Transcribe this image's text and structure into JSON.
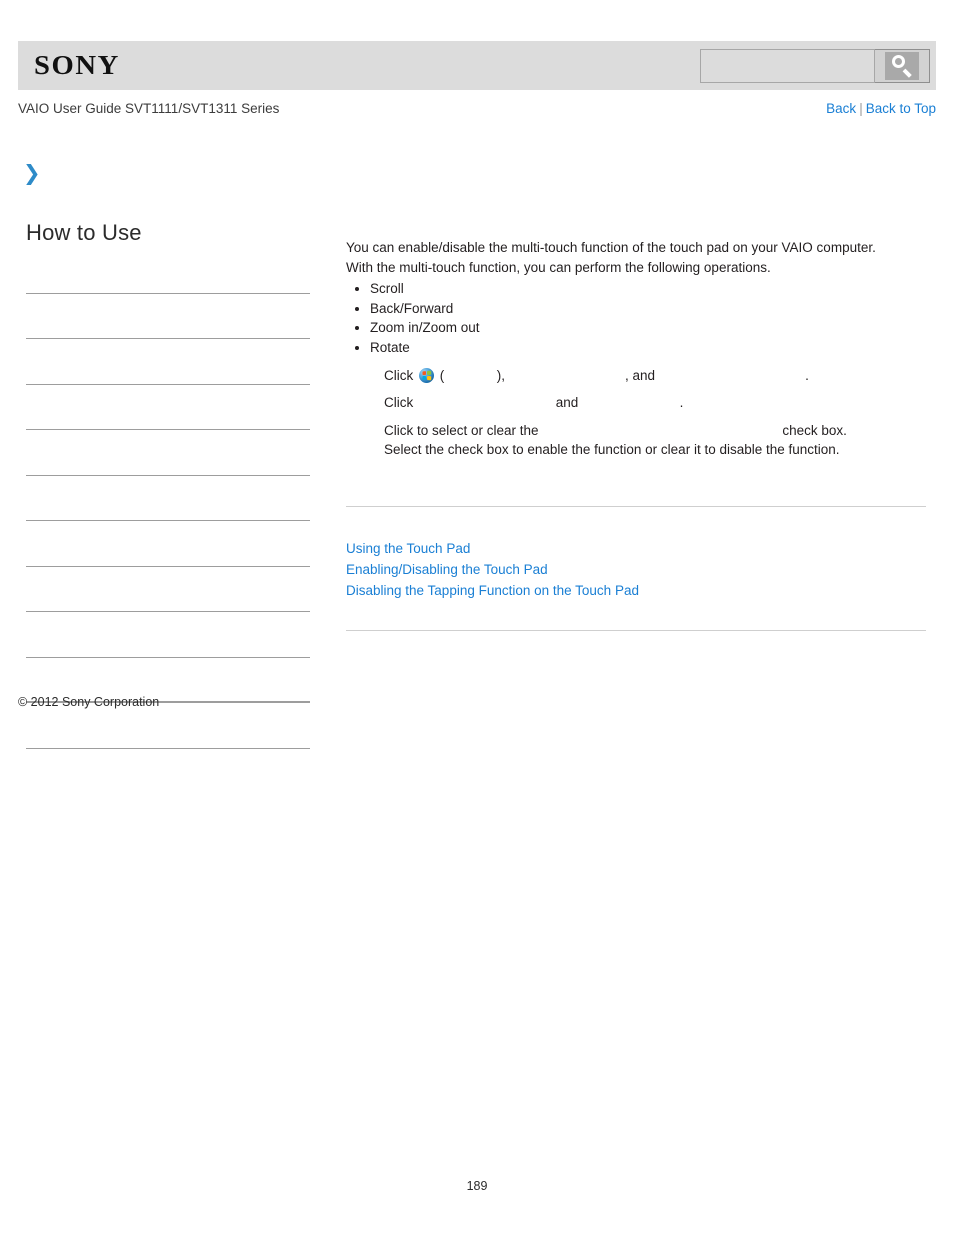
{
  "header": {
    "logo_text": "SONY",
    "search": {
      "value": "",
      "placeholder": "",
      "button_icon": "search-icon"
    }
  },
  "title_row": {
    "guide_title": "VAIO User Guide SVT1111/SVT1311 Series",
    "back_label": "Back",
    "separator": "|",
    "back_to_top_label": "Back to Top"
  },
  "sidebar": {
    "expand_icon": "double-chevron-right-icon",
    "heading": "How to Use",
    "items": [
      {
        "label": ""
      },
      {
        "label": ""
      },
      {
        "label": ""
      },
      {
        "label": ""
      },
      {
        "label": ""
      },
      {
        "label": ""
      },
      {
        "label": ""
      },
      {
        "label": ""
      },
      {
        "label": ""
      },
      {
        "label": ""
      },
      {
        "label": ""
      },
      {
        "label": ""
      }
    ],
    "copyright": "© 2012 Sony Corporation"
  },
  "content": {
    "intro_line_1": "You can enable/disable the multi-touch function of the touch pad on your VAIO computer.",
    "intro_line_2": "With the multi-touch function, you can perform the following operations.",
    "operations": [
      "Scroll",
      "Back/Forward",
      "Zoom in/Zoom out",
      "Rotate"
    ],
    "steps": {
      "step1_prefix": "Click ",
      "step1_icon": "windows-start-orb-icon",
      "step1_middle": " (              ),                                , and                                        .",
      "step2": "Click                                      and                           .",
      "step3_line1": "Click to select or clear the                                                                 check box.",
      "step3_line2": "Select the check box to enable the function or clear it to disable the function."
    },
    "related_links": [
      "Using the Touch Pad",
      "Enabling/Disabling the Touch Pad",
      "Disabling the Tapping Function on the Touch Pad"
    ]
  },
  "footer": {
    "page_number": "189"
  },
  "colors": {
    "header_band": "#dcdcdc",
    "link_blue": "#1a7fd4",
    "chevron_blue": "#2e8bc8",
    "divider_gray": "#9d9d9d",
    "rule_gray": "#cfcfcf"
  }
}
